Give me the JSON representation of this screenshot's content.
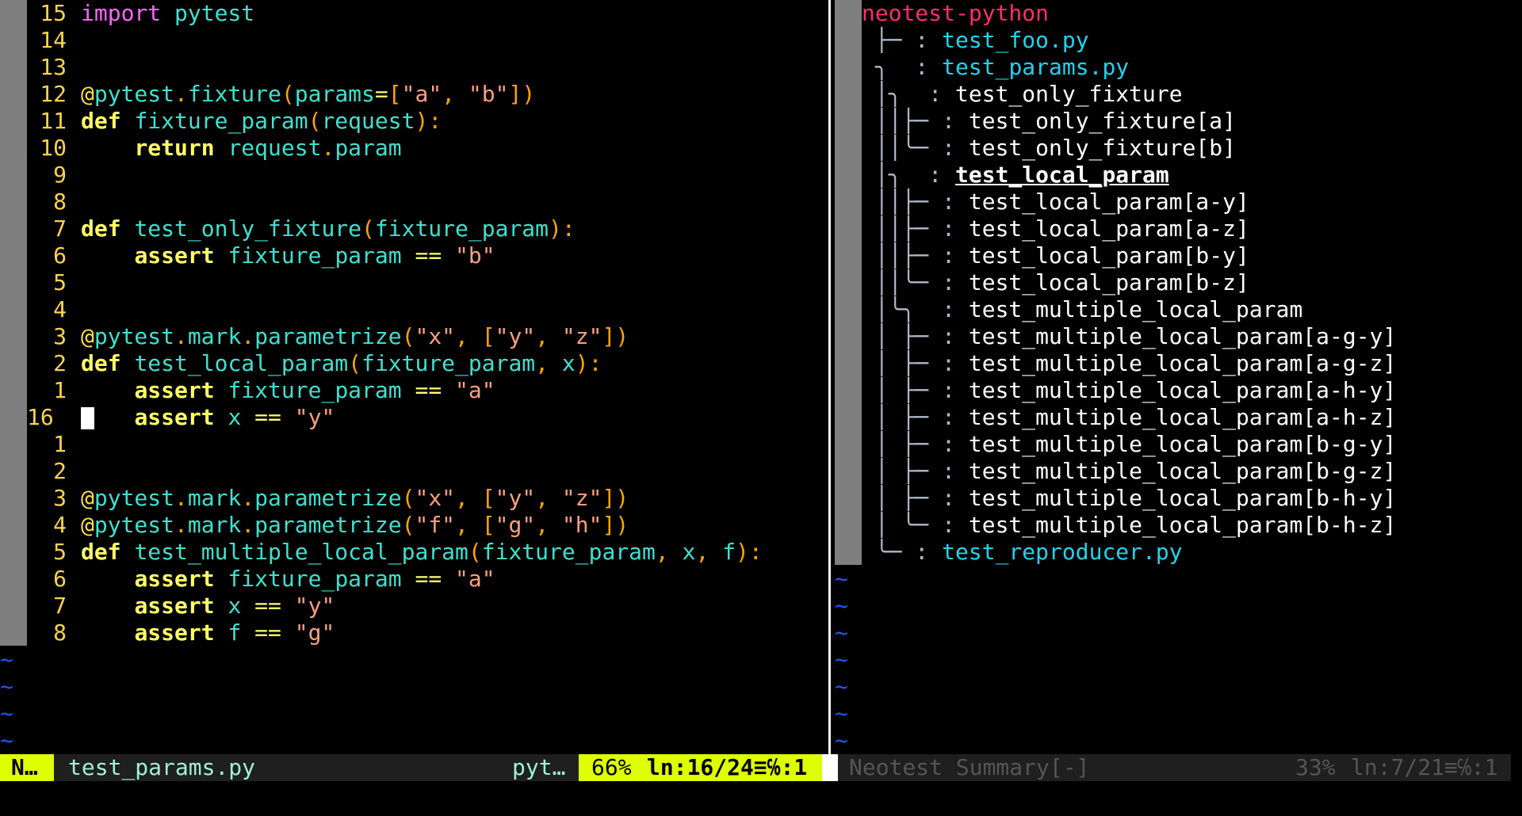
{
  "left": {
    "lines": [
      {
        "num": "15",
        "tokens": [
          [
            "kw-import",
            "import"
          ],
          [
            "white",
            " "
          ],
          [
            "id",
            "pytest"
          ]
        ]
      },
      {
        "num": "14",
        "tokens": []
      },
      {
        "num": "13",
        "tokens": []
      },
      {
        "num": "12",
        "tokens": [
          [
            "dec",
            "@"
          ],
          [
            "id",
            "pytest"
          ],
          [
            "pun",
            "."
          ],
          [
            "id",
            "fixture"
          ],
          [
            "pun",
            "("
          ],
          [
            "id",
            "params"
          ],
          [
            "op",
            "="
          ],
          [
            "pun",
            "["
          ],
          [
            "str",
            "\"a\""
          ],
          [
            "pun",
            ", "
          ],
          [
            "str",
            "\"b\""
          ],
          [
            "pun",
            "])"
          ]
        ]
      },
      {
        "num": "11",
        "tokens": [
          [
            "kw",
            "def"
          ],
          [
            "white",
            " "
          ],
          [
            "id",
            "fixture_param"
          ],
          [
            "pun",
            "("
          ],
          [
            "id",
            "request"
          ],
          [
            "pun",
            "):"
          ]
        ]
      },
      {
        "num": "10",
        "tokens": [
          [
            "white",
            "    "
          ],
          [
            "kw",
            "return"
          ],
          [
            "white",
            " "
          ],
          [
            "id",
            "request"
          ],
          [
            "pun",
            "."
          ],
          [
            "id",
            "param"
          ]
        ]
      },
      {
        "num": "9",
        "tokens": []
      },
      {
        "num": "8",
        "tokens": []
      },
      {
        "num": "7",
        "tokens": [
          [
            "kw",
            "def"
          ],
          [
            "white",
            " "
          ],
          [
            "id",
            "test_only_fixture"
          ],
          [
            "pun",
            "("
          ],
          [
            "id",
            "fixture_param"
          ],
          [
            "pun",
            "):"
          ]
        ]
      },
      {
        "num": "6",
        "tokens": [
          [
            "white",
            "    "
          ],
          [
            "kw",
            "assert"
          ],
          [
            "white",
            " "
          ],
          [
            "id",
            "fixture_param"
          ],
          [
            "white",
            " "
          ],
          [
            "op",
            "=="
          ],
          [
            "white",
            " "
          ],
          [
            "str",
            "\"b\""
          ]
        ]
      },
      {
        "num": "5",
        "tokens": []
      },
      {
        "num": "4",
        "tokens": []
      },
      {
        "num": "3",
        "tokens": [
          [
            "dec",
            "@"
          ],
          [
            "id",
            "pytest"
          ],
          [
            "pun",
            "."
          ],
          [
            "id",
            "mark"
          ],
          [
            "pun",
            "."
          ],
          [
            "id",
            "parametrize"
          ],
          [
            "pun",
            "("
          ],
          [
            "str",
            "\"x\""
          ],
          [
            "pun",
            ", ["
          ],
          [
            "str",
            "\"y\""
          ],
          [
            "pun",
            ", "
          ],
          [
            "str",
            "\"z\""
          ],
          [
            "pun",
            "])"
          ]
        ]
      },
      {
        "num": "2",
        "tokens": [
          [
            "kw",
            "def"
          ],
          [
            "white",
            " "
          ],
          [
            "id",
            "test_local_param"
          ],
          [
            "pun",
            "("
          ],
          [
            "id",
            "fixture_param"
          ],
          [
            "pun",
            ", "
          ],
          [
            "id",
            "x"
          ],
          [
            "pun",
            "):"
          ]
        ]
      },
      {
        "num": "1",
        "tokens": [
          [
            "white",
            "    "
          ],
          [
            "kw",
            "assert"
          ],
          [
            "white",
            " "
          ],
          [
            "id",
            "fixture_param"
          ],
          [
            "white",
            " "
          ],
          [
            "op",
            "=="
          ],
          [
            "white",
            " "
          ],
          [
            "str",
            "\"a\""
          ]
        ]
      },
      {
        "num": "16",
        "current": true,
        "tokens": [
          [
            "white",
            "    "
          ],
          [
            "kw",
            "assert"
          ],
          [
            "white",
            " "
          ],
          [
            "id",
            "x"
          ],
          [
            "white",
            " "
          ],
          [
            "op",
            "=="
          ],
          [
            "white",
            " "
          ],
          [
            "str",
            "\"y\""
          ]
        ]
      },
      {
        "num": "1",
        "tokens": []
      },
      {
        "num": "2",
        "tokens": []
      },
      {
        "num": "3",
        "tokens": [
          [
            "dec",
            "@"
          ],
          [
            "id",
            "pytest"
          ],
          [
            "pun",
            "."
          ],
          [
            "id",
            "mark"
          ],
          [
            "pun",
            "."
          ],
          [
            "id",
            "parametrize"
          ],
          [
            "pun",
            "("
          ],
          [
            "str",
            "\"x\""
          ],
          [
            "pun",
            ", ["
          ],
          [
            "str",
            "\"y\""
          ],
          [
            "pun",
            ", "
          ],
          [
            "str",
            "\"z\""
          ],
          [
            "pun",
            "])"
          ]
        ]
      },
      {
        "num": "4",
        "tokens": [
          [
            "dec",
            "@"
          ],
          [
            "id",
            "pytest"
          ],
          [
            "pun",
            "."
          ],
          [
            "id",
            "mark"
          ],
          [
            "pun",
            "."
          ],
          [
            "id",
            "parametrize"
          ],
          [
            "pun",
            "("
          ],
          [
            "str",
            "\"f\""
          ],
          [
            "pun",
            ", ["
          ],
          [
            "str",
            "\"g\""
          ],
          [
            "pun",
            ", "
          ],
          [
            "str",
            "\"h\""
          ],
          [
            "pun",
            "])"
          ]
        ]
      },
      {
        "num": "5",
        "tokens": [
          [
            "kw",
            "def"
          ],
          [
            "white",
            " "
          ],
          [
            "id",
            "test_multiple_local_param"
          ],
          [
            "pun",
            "("
          ],
          [
            "id",
            "fixture_param"
          ],
          [
            "pun",
            ", "
          ],
          [
            "id",
            "x"
          ],
          [
            "pun",
            ", "
          ],
          [
            "id",
            "f"
          ],
          [
            "pun",
            "):"
          ]
        ]
      },
      {
        "num": "6",
        "tokens": [
          [
            "white",
            "    "
          ],
          [
            "kw",
            "assert"
          ],
          [
            "white",
            " "
          ],
          [
            "id",
            "fixture_param"
          ],
          [
            "white",
            " "
          ],
          [
            "op",
            "=="
          ],
          [
            "white",
            " "
          ],
          [
            "str",
            "\"a\""
          ]
        ]
      },
      {
        "num": "7",
        "tokens": [
          [
            "white",
            "    "
          ],
          [
            "kw",
            "assert"
          ],
          [
            "white",
            " "
          ],
          [
            "id",
            "x"
          ],
          [
            "white",
            " "
          ],
          [
            "op",
            "=="
          ],
          [
            "white",
            " "
          ],
          [
            "str",
            "\"y\""
          ]
        ]
      },
      {
        "num": "8",
        "tokens": [
          [
            "white",
            "    "
          ],
          [
            "kw",
            "assert"
          ],
          [
            "white",
            " "
          ],
          [
            "id",
            "f"
          ],
          [
            "white",
            " "
          ],
          [
            "op",
            "=="
          ],
          [
            "white",
            " "
          ],
          [
            "str",
            "\"g\""
          ]
        ]
      }
    ],
    "tilde": "~"
  },
  "right": {
    "tree": [
      {
        "branch": "",
        "text": "neotest-python",
        "kind": "head"
      },
      {
        "branch": " ├─ : ",
        "text": "test_foo.py",
        "kind": "file"
      },
      {
        "branch": " ╮  : ",
        "text": "test_params.py",
        "kind": "file"
      },
      {
        "branch": " │╮  : ",
        "text": "test_only_fixture",
        "kind": "test"
      },
      {
        "branch": " ││├─ : ",
        "text": "test_only_fixture[a]",
        "kind": "test"
      },
      {
        "branch": " ││╰─ : ",
        "text": "test_only_fixture[b]",
        "kind": "test"
      },
      {
        "branch": " │╮  : ",
        "text": "test_local_param",
        "kind": "test-bold"
      },
      {
        "branch": " ││├─ : ",
        "text": "test_local_param[a-y]",
        "kind": "test"
      },
      {
        "branch": " ││├─ : ",
        "text": "test_local_param[a-z]",
        "kind": "test"
      },
      {
        "branch": " ││├─ : ",
        "text": "test_local_param[b-y]",
        "kind": "test"
      },
      {
        "branch": " ││╰─ : ",
        "text": "test_local_param[b-z]",
        "kind": "test"
      },
      {
        "branch": " │╰╮  : ",
        "text": "test_multiple_local_param",
        "kind": "test"
      },
      {
        "branch": " │ ├─ : ",
        "text": "test_multiple_local_param[a-g-y]",
        "kind": "test"
      },
      {
        "branch": " │ ├─ : ",
        "text": "test_multiple_local_param[a-g-z]",
        "kind": "test"
      },
      {
        "branch": " │ ├─ : ",
        "text": "test_multiple_local_param[a-h-y]",
        "kind": "test"
      },
      {
        "branch": " │ ├─ : ",
        "text": "test_multiple_local_param[a-h-z]",
        "kind": "test"
      },
      {
        "branch": " │ ├─ : ",
        "text": "test_multiple_local_param[b-g-y]",
        "kind": "test"
      },
      {
        "branch": " │ ├─ : ",
        "text": "test_multiple_local_param[b-g-z]",
        "kind": "test"
      },
      {
        "branch": " │ ├─ : ",
        "text": "test_multiple_local_param[b-h-y]",
        "kind": "test"
      },
      {
        "branch": " │ ╰─ : ",
        "text": "test_multiple_local_param[b-h-z]",
        "kind": "test"
      },
      {
        "branch": " ╰─ : ",
        "text": "test_reproducer.py",
        "kind": "file"
      }
    ],
    "tilde": "~"
  },
  "statusline_left": {
    "mode": "N…",
    "filename": "test_params.py",
    "filetype": "pyt…",
    "percent": "66%",
    "position": "ln:16/24≡℅:1"
  },
  "statusline_right": {
    "title": "Neotest Summary[-]",
    "percent": "33%",
    "position": "ln:7/21≡℅:1"
  },
  "colors": {
    "mode_bg": "#ddff00",
    "tree_head": "#ff2d70",
    "tree_file": "#22d3ee",
    "tilde": "#2255ff"
  }
}
